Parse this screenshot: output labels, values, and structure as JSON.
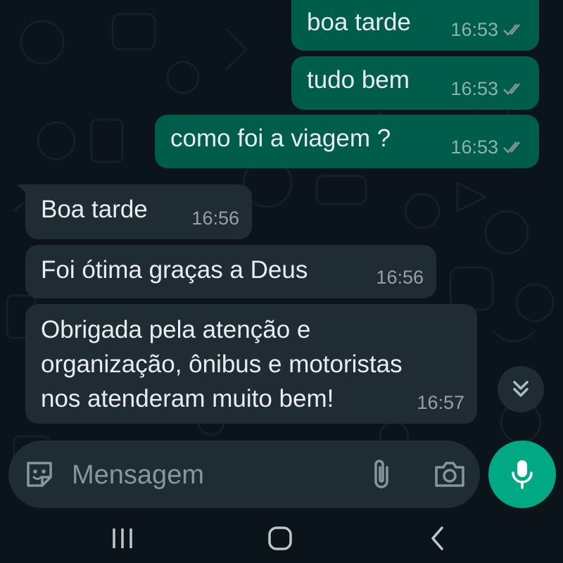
{
  "chat": {
    "messages": [
      {
        "direction": "outgoing",
        "text": "boa tarde",
        "time": "16:53",
        "status": "read"
      },
      {
        "direction": "outgoing",
        "text": "tudo bem",
        "time": "16:53",
        "status": "read"
      },
      {
        "direction": "outgoing",
        "text": "como foi a viagem ?",
        "time": "16:53",
        "status": "read"
      },
      {
        "direction": "incoming",
        "text": "Boa tarde",
        "time": "16:56"
      },
      {
        "direction": "incoming",
        "text": "Foi ótima graças a Deus",
        "time": "16:56"
      },
      {
        "direction": "incoming",
        "text": "Obrigada pela atenção e\norganização, ônibus e motoristas\nnos atenderam muito bem!",
        "time": "16:57"
      }
    ]
  },
  "composer": {
    "placeholder": "Mensagem",
    "emoji_icon": "sticker-icon",
    "attach_icon": "paperclip-icon",
    "camera_icon": "camera-icon",
    "mic_icon": "microphone-icon"
  },
  "scroll_button": {
    "icon": "double-chevron-down-icon"
  },
  "navbar": {
    "recent_icon": "recent-apps-icon",
    "home_icon": "home-icon",
    "back_icon": "back-icon"
  },
  "colors": {
    "background": "#0b141a",
    "outgoing_bubble": "#005c4b",
    "incoming_bubble": "#1f2c34",
    "accent": "#00a884",
    "read_ticks": "#8696a0"
  }
}
